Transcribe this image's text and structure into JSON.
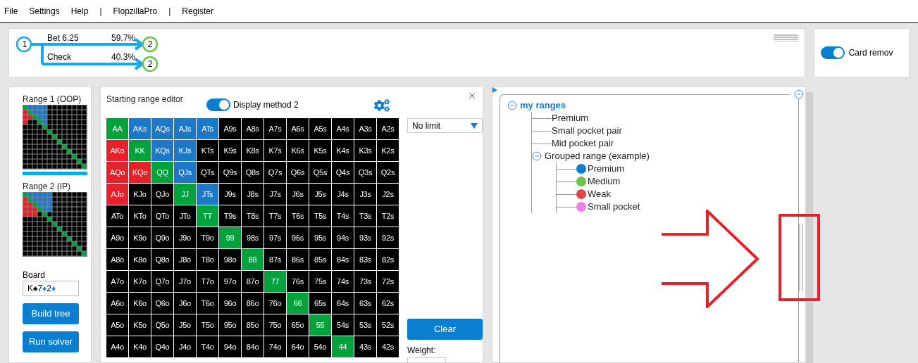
{
  "menu": [
    "File",
    "Settings",
    "Help",
    "|",
    "FlopzillaPro",
    "|",
    "Register"
  ],
  "tree": {
    "root": "1",
    "branches": [
      {
        "action": "Bet 6.25",
        "percent": "59.7%",
        "node": "2"
      },
      {
        "action": "Check",
        "percent": "40.3%",
        "node": "2"
      }
    ]
  },
  "card_removal": {
    "label": "Card remov",
    "on": true
  },
  "ranges": [
    {
      "label": "Range 1 (OOP)",
      "selected": true
    },
    {
      "label": "Range 2 (IP)",
      "selected": false
    }
  ],
  "board": {
    "label": "Board",
    "cards": [
      {
        "rank": "K",
        "suit": "♠",
        "color": "#000000"
      },
      {
        "rank": "7",
        "suit": "♦",
        "color": "#1e88e5"
      },
      {
        "rank": "2",
        "suit": "♦",
        "color": "#1e88e5"
      }
    ]
  },
  "buttons": [
    "Build tree",
    "Run solver"
  ],
  "editor": {
    "title": "Starting range editor",
    "display_toggle": {
      "label": "Display method 2",
      "on": true
    },
    "limit": "No limit",
    "clear": "Clear",
    "weight_label": "Weight:",
    "grid": [
      [
        {
          "label": "AA",
          "color": "#00a33b"
        },
        {
          "label": "AKs",
          "color": "#1e78c8"
        },
        {
          "label": "AQs",
          "color": "#1e78c8"
        },
        {
          "label": "AJs",
          "color": "#1e78c8"
        },
        {
          "label": "ATs",
          "color": "#1e78c8"
        },
        {
          "label": "A9s",
          "color": "#000000"
        },
        {
          "label": "A8s",
          "color": "#000000"
        },
        {
          "label": "A7s",
          "color": "#000000"
        },
        {
          "label": "A6s",
          "color": "#000000"
        },
        {
          "label": "A5s",
          "color": "#000000"
        },
        {
          "label": "A4s",
          "color": "#000000"
        },
        {
          "label": "A3s",
          "color": "#000000"
        },
        {
          "label": "A2s",
          "color": "#000000"
        }
      ],
      [
        {
          "label": "AKo",
          "color": "#e8202a"
        },
        {
          "label": "KK",
          "color": "#00a33b"
        },
        {
          "label": "KQs",
          "color": "#1e78c8"
        },
        {
          "label": "KJs",
          "color": "#1e78c8"
        },
        {
          "label": "KTs",
          "color": "#000000"
        },
        {
          "label": "K9s",
          "color": "#000000"
        },
        {
          "label": "K8s",
          "color": "#000000"
        },
        {
          "label": "K7s",
          "color": "#000000"
        },
        {
          "label": "K6s",
          "color": "#000000"
        },
        {
          "label": "K5s",
          "color": "#000000"
        },
        {
          "label": "K4s",
          "color": "#000000"
        },
        {
          "label": "K3s",
          "color": "#000000"
        },
        {
          "label": "K2s",
          "color": "#000000"
        }
      ],
      [
        {
          "label": "AQo",
          "color": "#e8202a"
        },
        {
          "label": "KQo",
          "color": "#e8202a"
        },
        {
          "label": "QQ",
          "color": "#00a33b"
        },
        {
          "label": "QJs",
          "color": "#1e78c8"
        },
        {
          "label": "QTs",
          "color": "#000000"
        },
        {
          "label": "Q9s",
          "color": "#000000"
        },
        {
          "label": "Q8s",
          "color": "#000000"
        },
        {
          "label": "Q7s",
          "color": "#000000"
        },
        {
          "label": "Q6s",
          "color": "#000000"
        },
        {
          "label": "Q5s",
          "color": "#000000"
        },
        {
          "label": "Q4s",
          "color": "#000000"
        },
        {
          "label": "Q3s",
          "color": "#000000"
        },
        {
          "label": "Q2s",
          "color": "#000000"
        }
      ],
      [
        {
          "label": "AJo",
          "color": "#e8202a"
        },
        {
          "label": "KJo",
          "color": "#000000"
        },
        {
          "label": "QJo",
          "color": "#000000"
        },
        {
          "label": "JJ",
          "color": "#00a33b"
        },
        {
          "label": "JTs",
          "color": "#1e78c8"
        },
        {
          "label": "J9s",
          "color": "#000000"
        },
        {
          "label": "J8s",
          "color": "#000000"
        },
        {
          "label": "J7s",
          "color": "#000000"
        },
        {
          "label": "J6s",
          "color": "#000000"
        },
        {
          "label": "J5s",
          "color": "#000000"
        },
        {
          "label": "J4s",
          "color": "#000000"
        },
        {
          "label": "J3s",
          "color": "#000000"
        },
        {
          "label": "J2s",
          "color": "#000000"
        }
      ],
      [
        {
          "label": "ATo",
          "color": "#000000"
        },
        {
          "label": "KTo",
          "color": "#000000"
        },
        {
          "label": "QTo",
          "color": "#000000"
        },
        {
          "label": "JTo",
          "color": "#000000"
        },
        {
          "label": "TT",
          "color": "#00a33b"
        },
        {
          "label": "T9s",
          "color": "#000000"
        },
        {
          "label": "T8s",
          "color": "#000000"
        },
        {
          "label": "T7s",
          "color": "#000000"
        },
        {
          "label": "T6s",
          "color": "#000000"
        },
        {
          "label": "T5s",
          "color": "#000000"
        },
        {
          "label": "T4s",
          "color": "#000000"
        },
        {
          "label": "T3s",
          "color": "#000000"
        },
        {
          "label": "T2s",
          "color": "#000000"
        }
      ],
      [
        {
          "label": "A9o",
          "color": "#000000"
        },
        {
          "label": "K9o",
          "color": "#000000"
        },
        {
          "label": "Q9o",
          "color": "#000000"
        },
        {
          "label": "J9o",
          "color": "#000000"
        },
        {
          "label": "T9o",
          "color": "#000000"
        },
        {
          "label": "99",
          "color": "#00a33b"
        },
        {
          "label": "98s",
          "color": "#000000"
        },
        {
          "label": "97s",
          "color": "#000000"
        },
        {
          "label": "96s",
          "color": "#000000"
        },
        {
          "label": "95s",
          "color": "#000000"
        },
        {
          "label": "94s",
          "color": "#000000"
        },
        {
          "label": "93s",
          "color": "#000000"
        },
        {
          "label": "92s",
          "color": "#000000"
        }
      ],
      [
        {
          "label": "A8o",
          "color": "#000000"
        },
        {
          "label": "K8o",
          "color": "#000000"
        },
        {
          "label": "Q8o",
          "color": "#000000"
        },
        {
          "label": "J8o",
          "color": "#000000"
        },
        {
          "label": "T8o",
          "color": "#000000"
        },
        {
          "label": "98o",
          "color": "#000000"
        },
        {
          "label": "88",
          "color": "#00a33b"
        },
        {
          "label": "87s",
          "color": "#000000"
        },
        {
          "label": "86s",
          "color": "#000000"
        },
        {
          "label": "85s",
          "color": "#000000"
        },
        {
          "label": "84s",
          "color": "#000000"
        },
        {
          "label": "83s",
          "color": "#000000"
        },
        {
          "label": "82s",
          "color": "#000000"
        }
      ],
      [
        {
          "label": "A7o",
          "color": "#000000"
        },
        {
          "label": "K7o",
          "color": "#000000"
        },
        {
          "label": "Q7o",
          "color": "#000000"
        },
        {
          "label": "J7o",
          "color": "#000000"
        },
        {
          "label": "T7o",
          "color": "#000000"
        },
        {
          "label": "97o",
          "color": "#000000"
        },
        {
          "label": "87o",
          "color": "#000000"
        },
        {
          "label": "77",
          "color": "#00a33b"
        },
        {
          "label": "76s",
          "color": "#000000"
        },
        {
          "label": "75s",
          "color": "#000000"
        },
        {
          "label": "74s",
          "color": "#000000"
        },
        {
          "label": "73s",
          "color": "#000000"
        },
        {
          "label": "72s",
          "color": "#000000"
        }
      ],
      [
        {
          "label": "A6o",
          "color": "#000000"
        },
        {
          "label": "K6o",
          "color": "#000000"
        },
        {
          "label": "Q6o",
          "color": "#000000"
        },
        {
          "label": "J6o",
          "color": "#000000"
        },
        {
          "label": "T6o",
          "color": "#000000"
        },
        {
          "label": "96o",
          "color": "#000000"
        },
        {
          "label": "86o",
          "color": "#000000"
        },
        {
          "label": "76o",
          "color": "#000000"
        },
        {
          "label": "66",
          "color": "#00a33b"
        },
        {
          "label": "65s",
          "color": "#000000"
        },
        {
          "label": "64s",
          "color": "#000000"
        },
        {
          "label": "63s",
          "color": "#000000"
        },
        {
          "label": "62s",
          "color": "#000000"
        }
      ],
      [
        {
          "label": "A5o",
          "color": "#000000"
        },
        {
          "label": "K5o",
          "color": "#000000"
        },
        {
          "label": "Q5o",
          "color": "#000000"
        },
        {
          "label": "J5o",
          "color": "#000000"
        },
        {
          "label": "T5o",
          "color": "#000000"
        },
        {
          "label": "95o",
          "color": "#000000"
        },
        {
          "label": "85o",
          "color": "#000000"
        },
        {
          "label": "75o",
          "color": "#000000"
        },
        {
          "label": "65o",
          "color": "#000000"
        },
        {
          "label": "55",
          "color": "#00a33b"
        },
        {
          "label": "54s",
          "color": "#000000"
        },
        {
          "label": "53s",
          "color": "#000000"
        },
        {
          "label": "52s",
          "color": "#000000"
        }
      ],
      [
        {
          "label": "A4o",
          "color": "#000000"
        },
        {
          "label": "K4o",
          "color": "#000000"
        },
        {
          "label": "Q4o",
          "color": "#000000"
        },
        {
          "label": "J4o",
          "color": "#000000"
        },
        {
          "label": "T4o",
          "color": "#000000"
        },
        {
          "label": "94o",
          "color": "#000000"
        },
        {
          "label": "84o",
          "color": "#000000"
        },
        {
          "label": "74o",
          "color": "#000000"
        },
        {
          "label": "64o",
          "color": "#000000"
        },
        {
          "label": "54o",
          "color": "#000000"
        },
        {
          "label": "44",
          "color": "#00a33b"
        },
        {
          "label": "43s",
          "color": "#000000"
        },
        {
          "label": "42s",
          "color": "#000000"
        }
      ]
    ]
  },
  "range_tree": {
    "label": "my ranges",
    "expanded": true,
    "children": [
      {
        "label": "Premium"
      },
      {
        "label": "Small pocket pair"
      },
      {
        "label": "Mid pocket pair"
      },
      {
        "label": "Grouped range (example)",
        "expanded": true,
        "children": [
          {
            "label": "Premium",
            "color": "#0a7fd0"
          },
          {
            "label": "Medium",
            "color": "#6cc24a"
          },
          {
            "label": "Weak",
            "color": "#e04848"
          },
          {
            "label": "Small pocket",
            "color": "#f47ee8"
          }
        ]
      }
    ]
  }
}
